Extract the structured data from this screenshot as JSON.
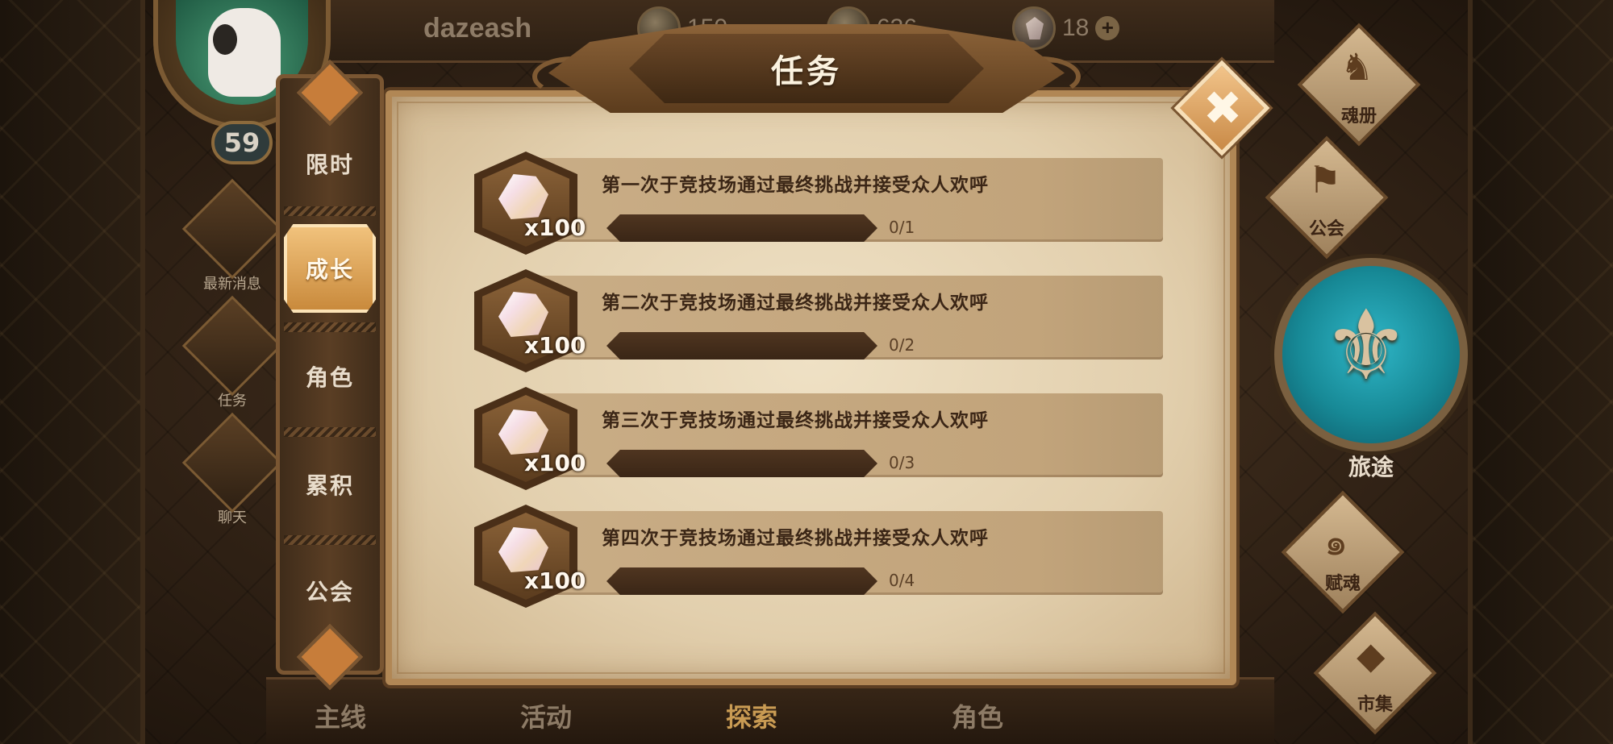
{
  "header": {
    "username": "dazeash",
    "currencies": [
      {
        "icon": "gold-coin-icon",
        "value": "150"
      },
      {
        "icon": "soul-coin-icon",
        "value": "636"
      },
      {
        "icon": "gem-icon",
        "value": "18"
      }
    ],
    "player_level": "59"
  },
  "left_quick_menu": [
    {
      "label": "最新消息",
      "icon": "news-cat-icon"
    },
    {
      "label": "任务",
      "icon": "quest-scroll-icon"
    },
    {
      "label": "聊天",
      "icon": "chat-bubble-icon"
    }
  ],
  "dialog": {
    "title": "任务",
    "close_label": "✖"
  },
  "categories": [
    {
      "label": "限时",
      "active": false
    },
    {
      "label": "成长",
      "active": true
    },
    {
      "label": "角色",
      "active": false
    },
    {
      "label": "累积",
      "active": false
    },
    {
      "label": "公会",
      "active": false
    }
  ],
  "quests": [
    {
      "title": "第一次于竞技场通过最终挑战并接受众人欢呼",
      "reward_icon": "gem-icon",
      "reward_count": "x100",
      "progress_text": "0/1",
      "progress": 0
    },
    {
      "title": "第二次于竞技场通过最终挑战并接受众人欢呼",
      "reward_icon": "gem-icon",
      "reward_count": "x100",
      "progress_text": "0/2",
      "progress": 0
    },
    {
      "title": "第三次于竞技场通过最终挑战并接受众人欢呼",
      "reward_icon": "gem-icon",
      "reward_count": "x100",
      "progress_text": "0/3",
      "progress": 0
    },
    {
      "title": "第四次于竞技场通过最终挑战并接受众人欢呼",
      "reward_icon": "gem-icon",
      "reward_count": "x100",
      "progress_text": "0/4",
      "progress": 0
    }
  ],
  "right_menu": [
    {
      "label": "魂册",
      "icon": "soul-book-icon"
    },
    {
      "label": "公会",
      "icon": "guild-banner-icon"
    },
    {
      "label": "旅途",
      "icon": "journey-emblem-icon"
    },
    {
      "label": "赋魂",
      "icon": "soul-flame-icon"
    },
    {
      "label": "市集",
      "icon": "market-gem-icon"
    }
  ],
  "bottom_nav": [
    {
      "label": "主线"
    },
    {
      "label": "活动"
    },
    {
      "label": "探索",
      "active": true
    },
    {
      "label": "角色"
    }
  ],
  "colors": {
    "parchment": "#e2cfad",
    "accent_tab": "#d9954a",
    "journey_teal": "#178996"
  }
}
